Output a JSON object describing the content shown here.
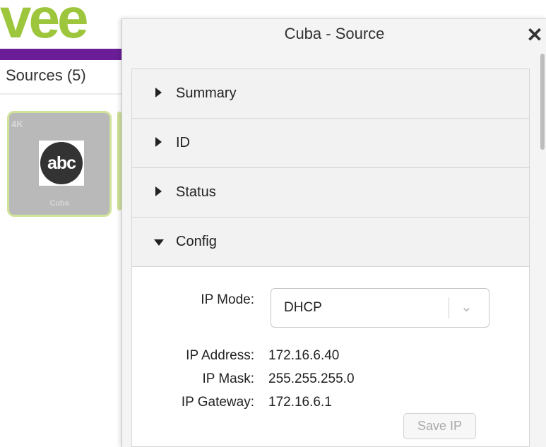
{
  "app": {
    "logo_text": "vee",
    "sources_label": "Sources (5)"
  },
  "tile": {
    "resolution": "4K",
    "logo_text": "abc",
    "name": "Cuba"
  },
  "modal": {
    "title": "Cuba - Source",
    "close_label": "✕",
    "sections": [
      {
        "label": "Summary",
        "expanded": false
      },
      {
        "label": "ID",
        "expanded": false
      },
      {
        "label": "Status",
        "expanded": false
      },
      {
        "label": "Config",
        "expanded": true
      }
    ],
    "config": {
      "ip_mode_label": "IP Mode:",
      "ip_mode_value": "DHCP",
      "ip_address_label": "IP Address:",
      "ip_address_value": "172.16.6.40",
      "ip_mask_label": "IP Mask:",
      "ip_mask_value": "255.255.255.0",
      "ip_gateway_label": "IP Gateway:",
      "ip_gateway_value": "172.16.6.1",
      "save_label": "Save IP"
    }
  },
  "colors": {
    "brand_green": "#9dc63c",
    "brand_purple": "#6a1d96"
  }
}
